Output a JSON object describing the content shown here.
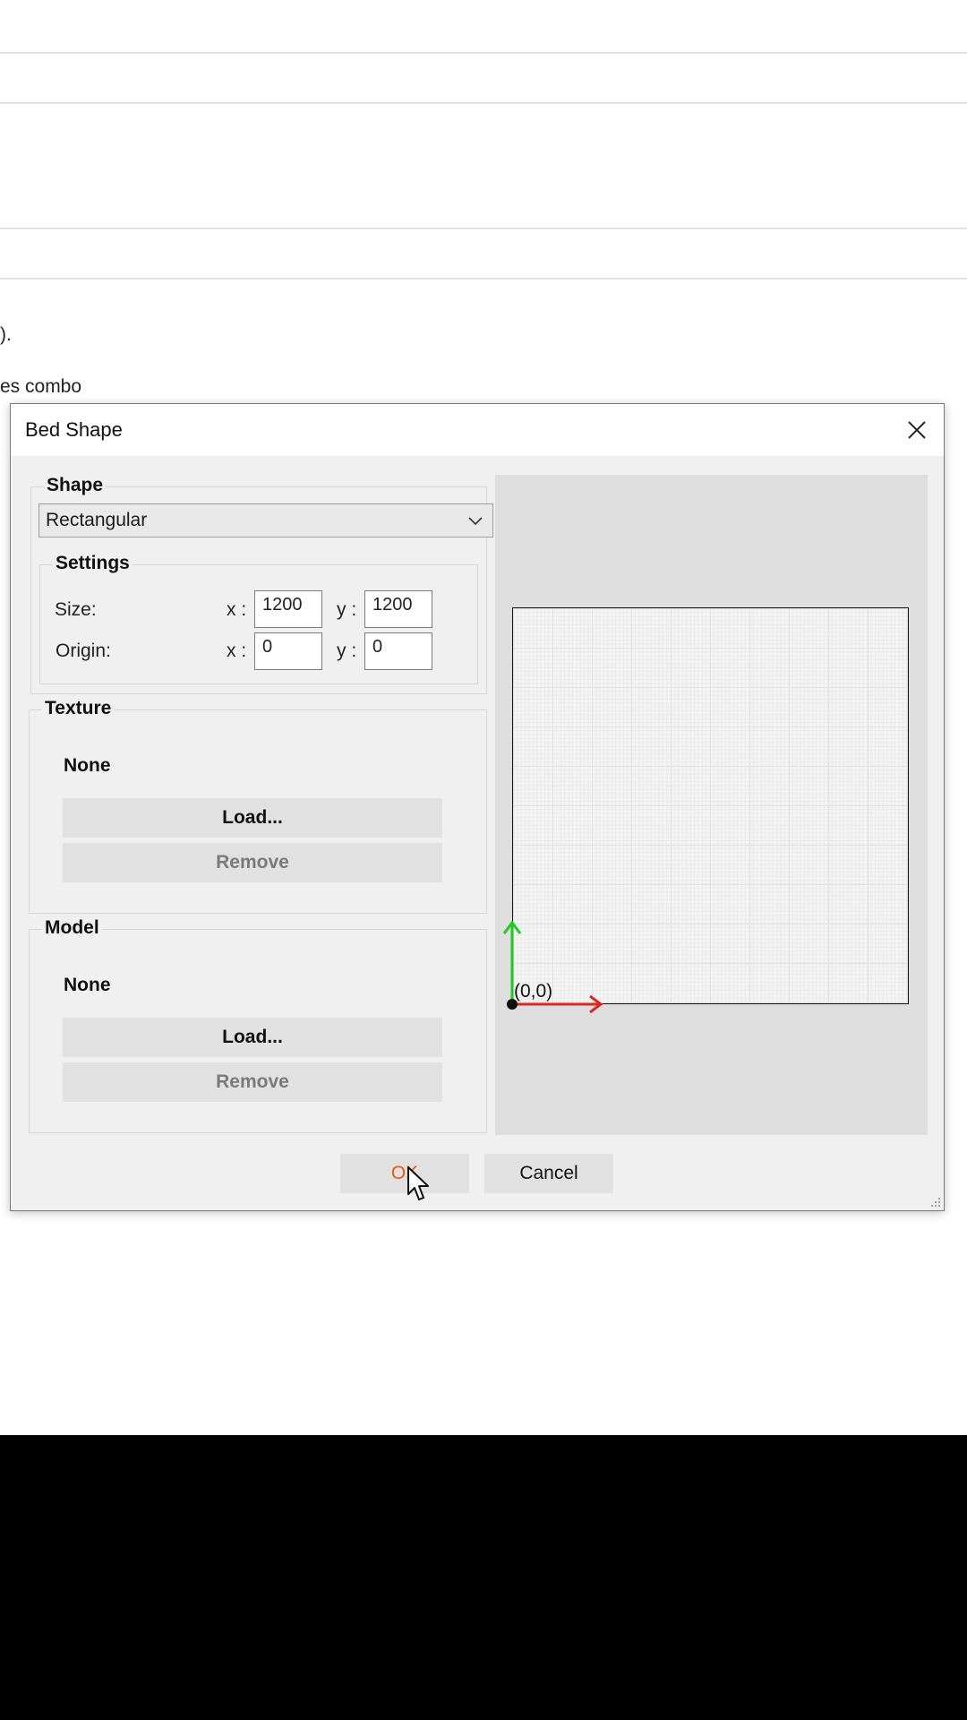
{
  "background": {
    "text_lines": [
      ").",
      "es combo"
    ]
  },
  "dialog": {
    "title": "Bed Shape",
    "shape": {
      "label": "Shape",
      "selected": "Rectangular",
      "settings": {
        "label": "Settings",
        "size_label": "Size:",
        "origin_label": "Origin:",
        "x_label": "x :",
        "y_label": "y :",
        "size_x": "1200",
        "size_y": "1200",
        "origin_x": "0",
        "origin_y": "0"
      }
    },
    "texture": {
      "label": "Texture",
      "value": "None",
      "load_label": "Load...",
      "remove_label": "Remove"
    },
    "model": {
      "label": "Model",
      "value": "None",
      "load_label": "Load...",
      "remove_label": "Remove"
    },
    "preview": {
      "origin_label": "(0,0)",
      "x_axis_color": "#d9281f",
      "y_axis_color": "#1fc91f"
    },
    "ok_label": "OK",
    "cancel_label": "Cancel"
  }
}
